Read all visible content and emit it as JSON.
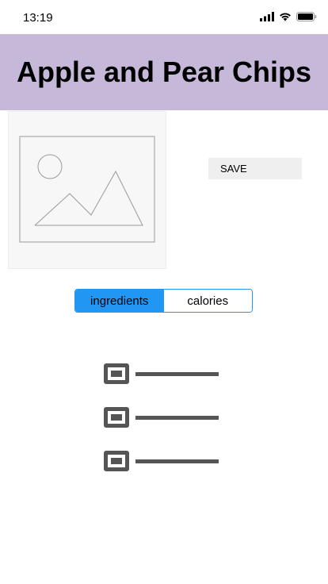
{
  "status_bar": {
    "time": "13:19",
    "icons": [
      "signal-icon",
      "wifi-icon",
      "battery-icon"
    ]
  },
  "header": {
    "title": "Apple and Pear Chips",
    "background_color": "#c5b8d9"
  },
  "image": {
    "icon": "image-placeholder-icon"
  },
  "save_button": {
    "label": "SAVE"
  },
  "tabs": {
    "items": [
      {
        "label": "ingredients",
        "active": true
      },
      {
        "label": "calories",
        "active": false
      }
    ],
    "accent_color": "#2196f3"
  },
  "checklist": {
    "items": [
      {
        "checked": false
      },
      {
        "checked": false
      },
      {
        "checked": false
      }
    ]
  }
}
